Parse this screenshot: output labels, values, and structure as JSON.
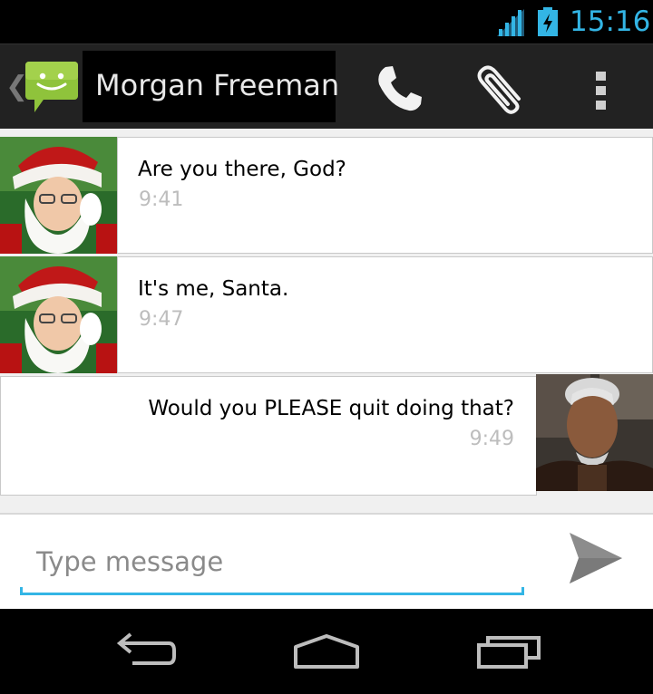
{
  "status_bar": {
    "time": "15:16"
  },
  "action_bar": {
    "title": "Morgan Freeman",
    "app_icon": "messaging-app-icon",
    "actions": [
      {
        "name": "call",
        "icon": "phone-icon"
      },
      {
        "name": "attach",
        "icon": "paperclip-icon"
      },
      {
        "name": "overflow",
        "icon": "overflow-menu-icon"
      }
    ]
  },
  "messages": [
    {
      "sender": "Santa",
      "direction": "incoming",
      "text": "Are you there, God?",
      "time": "9:41"
    },
    {
      "sender": "Santa",
      "direction": "incoming",
      "text": "It's me, Santa.",
      "time": "9:47"
    },
    {
      "sender": "Morgan Freeman",
      "direction": "outgoing",
      "text": "Would you PLEASE quit doing that?",
      "time": "9:49"
    }
  ],
  "compose": {
    "placeholder": "Type message",
    "value": ""
  },
  "colors": {
    "accent": "#33b5e5",
    "action_bar": "#222222",
    "thread_bg": "#f0f0f0",
    "app_icon_green": "#8fc33b"
  }
}
